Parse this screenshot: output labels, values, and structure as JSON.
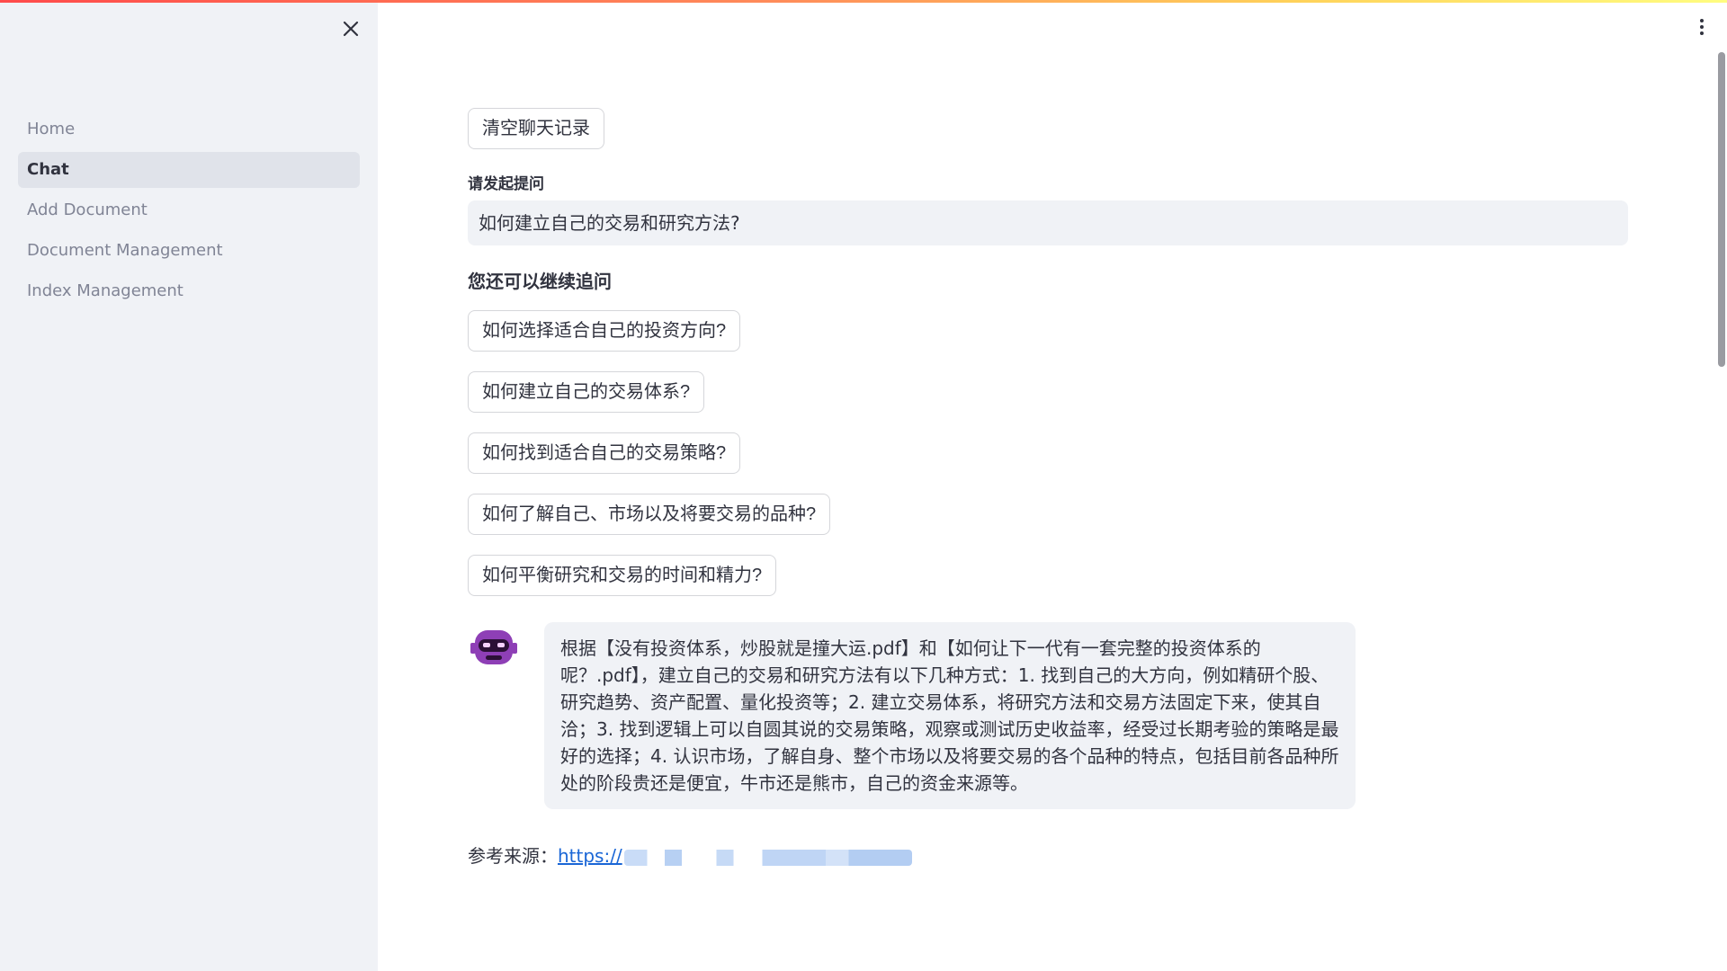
{
  "sidebar": {
    "items": [
      {
        "label": "Home"
      },
      {
        "label": "Chat"
      },
      {
        "label": "Add Document"
      },
      {
        "label": "Document Management"
      },
      {
        "label": "Index Management"
      }
    ],
    "active": "Chat"
  },
  "main": {
    "clear_button": "清空聊天记录",
    "question_label": "请发起提问",
    "question_value": "如何建立自己的交易和研究方法?",
    "followup_title": "您还可以继续追问",
    "followups": [
      "如何选择适合自己的投资方向?",
      "如何建立自己的交易体系?",
      "如何找到适合自己的交易策略?",
      "如何了解自己、市场以及将要交易的品种?",
      "如何平衡研究和交易的时间和精力?"
    ],
    "answer": "根据【没有投资体系，炒股就是撞大运.pdf】和【如何让下一代有一套完整的投资体系的呢？.pdf】，建立自己的交易和研究方法有以下几种方式：1. 找到自己的大方向，例如精研个股、研究趋势、资产配置、量化投资等；2. 建立交易体系，将研究方法和交易方法固定下来，使其自洽；3. 找到逻辑上可以自圆其说的交易策略，观察或测试历史收益率，经受过长期考验的策略是最好的选择；4. 认识市场，了解自身、整个市场以及将要交易的各个品种的特点，包括目前各品种所处的阶段贵还是便宜，牛市还是熊市，自己的资金来源等。",
    "reference_label": "参考来源：",
    "reference_link": "https://"
  },
  "icons": {
    "close": "close-icon",
    "menu": "more-vertical-icon",
    "avatar": "robot-avatar-icon"
  },
  "colors": {
    "sidebar_bg": "#f0f2f6",
    "link": "#1a66d6",
    "avatar": "#8e3fb6"
  }
}
